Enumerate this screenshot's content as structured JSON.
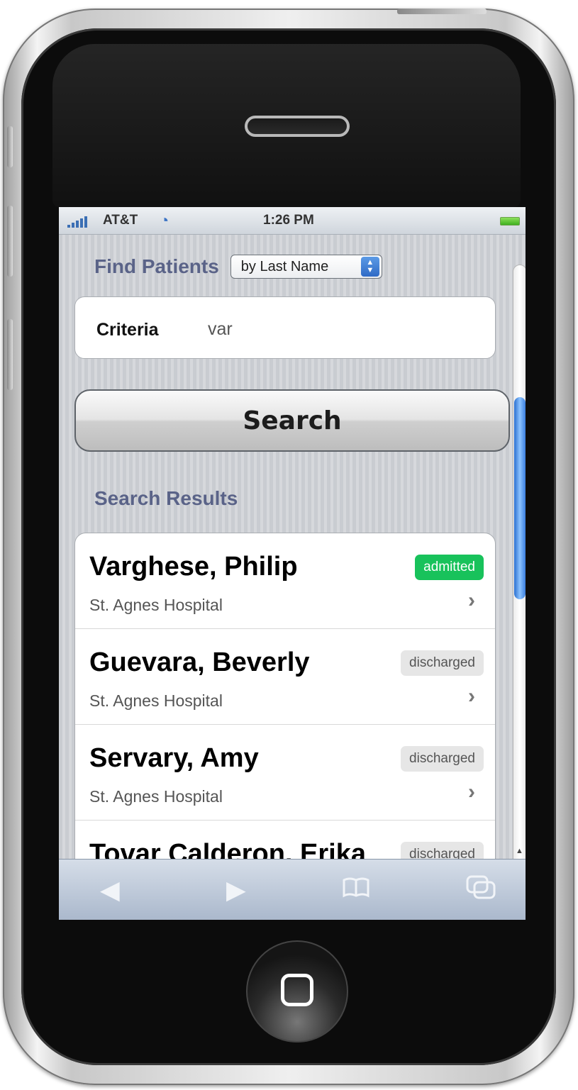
{
  "status_bar": {
    "carrier": "AT&T",
    "time": "1:26 PM"
  },
  "find": {
    "title": "Find Patients",
    "select_value": "by Last Name"
  },
  "criteria": {
    "label": "Criteria",
    "value": "var"
  },
  "search_button": {
    "label": "Search"
  },
  "results": {
    "title": "Search Results",
    "items": [
      {
        "name": "Varghese, Philip",
        "hospital": "St. Agnes Hospital",
        "status": "admitted"
      },
      {
        "name": "Guevara, Beverly",
        "hospital": "St. Agnes Hospital",
        "status": "discharged"
      },
      {
        "name": "Servary, Amy",
        "hospital": "St. Agnes Hospital",
        "status": "discharged"
      },
      {
        "name": "Tovar Calderon, Erika",
        "hospital": "",
        "status": "discharged"
      }
    ]
  },
  "colors": {
    "heading": "#5a6388",
    "admitted": "#18c25b",
    "discharged": "#e6e6e6",
    "scroll_thumb": "#3a7fe0"
  },
  "icons": {
    "toolbar": [
      "back-arrow-icon",
      "forward-arrow-icon",
      "bookmarks-icon",
      "pages-icon"
    ]
  }
}
